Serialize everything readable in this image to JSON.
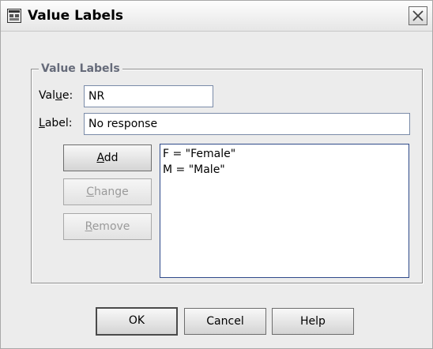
{
  "window": {
    "title": "Value Labels",
    "icon": "dialog-app-icon",
    "close_icon": "close-icon"
  },
  "group": {
    "legend": "Value Labels"
  },
  "value_field": {
    "label_pre": "Val",
    "label_mnemonic": "u",
    "label_post": "e:",
    "value": "NR"
  },
  "label_field": {
    "label_mnemonic": "L",
    "label_post": "abel:",
    "value": "No response"
  },
  "buttons": {
    "add": {
      "mnemonic": "A",
      "rest": "dd"
    },
    "change": {
      "mnemonic": "C",
      "rest": "hange"
    },
    "remove": {
      "mnemonic": "R",
      "rest": "emove"
    }
  },
  "list": {
    "items": [
      "F = \"Female\"",
      "M = \"Male\""
    ]
  },
  "footer": {
    "ok": "OK",
    "cancel": "Cancel",
    "help": "Help"
  }
}
